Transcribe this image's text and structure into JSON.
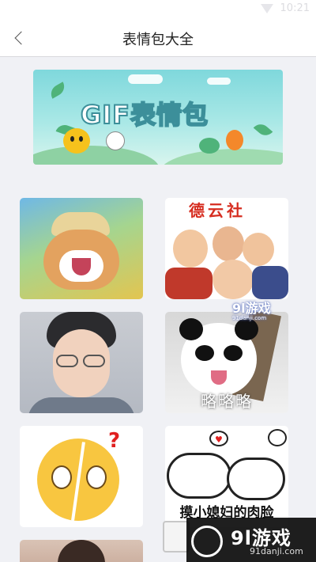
{
  "status_bar": {
    "time": "10:21"
  },
  "header": {
    "title": "表情包大全",
    "back_icon": "chevron-left-icon"
  },
  "banner": {
    "title": "GIF表情包"
  },
  "grid": {
    "items": [
      {
        "image": "shiba-dog-straw-hat"
      },
      {
        "image": "comedy-group-caricature",
        "caption_top": "德云社"
      },
      {
        "image": "young-man-glasses"
      },
      {
        "image": "panda-tongue",
        "caption": "略略略"
      },
      {
        "image": "cracked-emoji-question"
      },
      {
        "image": "two-blob-faces-hearts",
        "caption": "摸小媳妇的肉脸"
      },
      {
        "image": "woman-portrait"
      }
    ]
  },
  "watermarks": {
    "top": {
      "logo": "9l游戏",
      "domain": "91danji.com"
    },
    "bottom": {
      "logo": "9l游戏",
      "domain": "91danji.com"
    }
  },
  "colors": {
    "background": "#f0f1f5",
    "header_bg": "#ffffff",
    "banner_teal": "#7fd8dc"
  }
}
